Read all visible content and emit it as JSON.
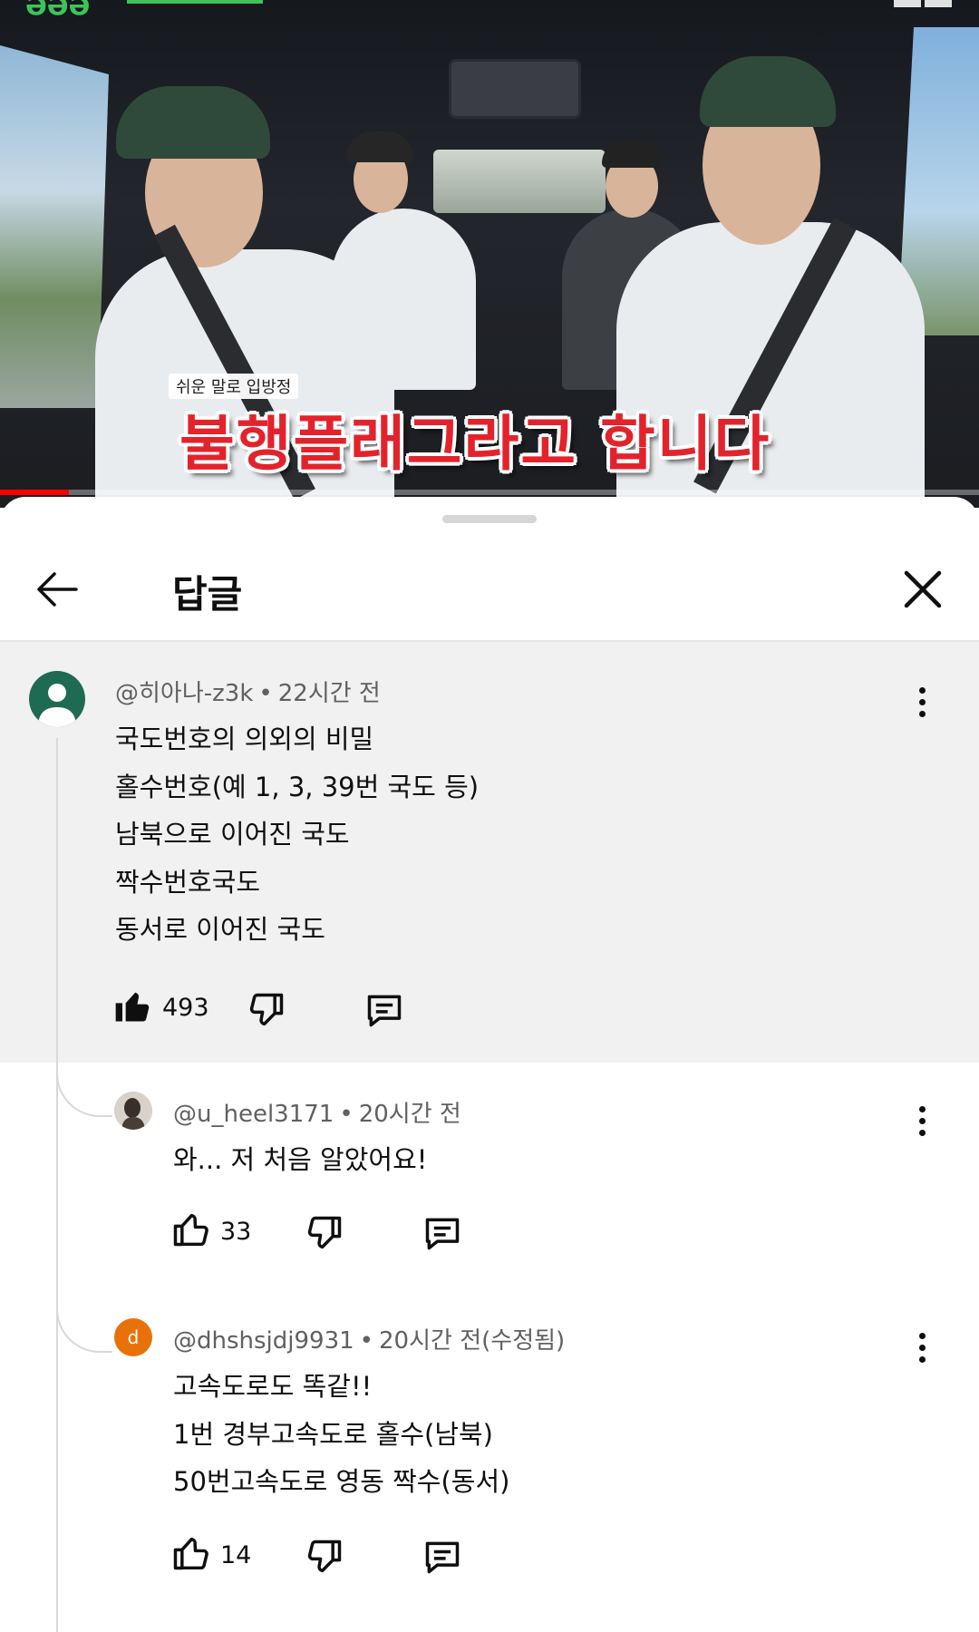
{
  "video": {
    "caption_small": "쉬운 말로 입방정",
    "caption_big": "불행플래그라고 합니다",
    "progress": 0.07
  },
  "sheet": {
    "title": "답글",
    "back_icon": "arrow-left-icon",
    "close_icon": "close-icon"
  },
  "parent_comment": {
    "author": "@히아나-z3k",
    "time": "22시간 전",
    "lines": [
      "국도번호의 의외의 비밀",
      "홀수번호(예 1, 3, 39번 국도 등)",
      "남북으로 이어진 국도",
      "짝수번호국도",
      "동서로 이어진 국도"
    ],
    "likes": "493",
    "avatar_color": "#1e6a52"
  },
  "replies": [
    {
      "author": "@u_heel3171",
      "time": "20시간 전",
      "lines": [
        "와... 저 처음 알았어요!"
      ],
      "likes": "33"
    },
    {
      "author": "@dhshsjdj9931",
      "time": "20시간 전(수정됨)",
      "avatar_letter": "d",
      "avatar_color": "#e8710a",
      "lines": [
        "고속도로도 똑같!!",
        "1번 경부고속도로 홀수(남북)",
        "50번고속도로 영동 짝수(동서)"
      ],
      "likes": "14"
    }
  ]
}
